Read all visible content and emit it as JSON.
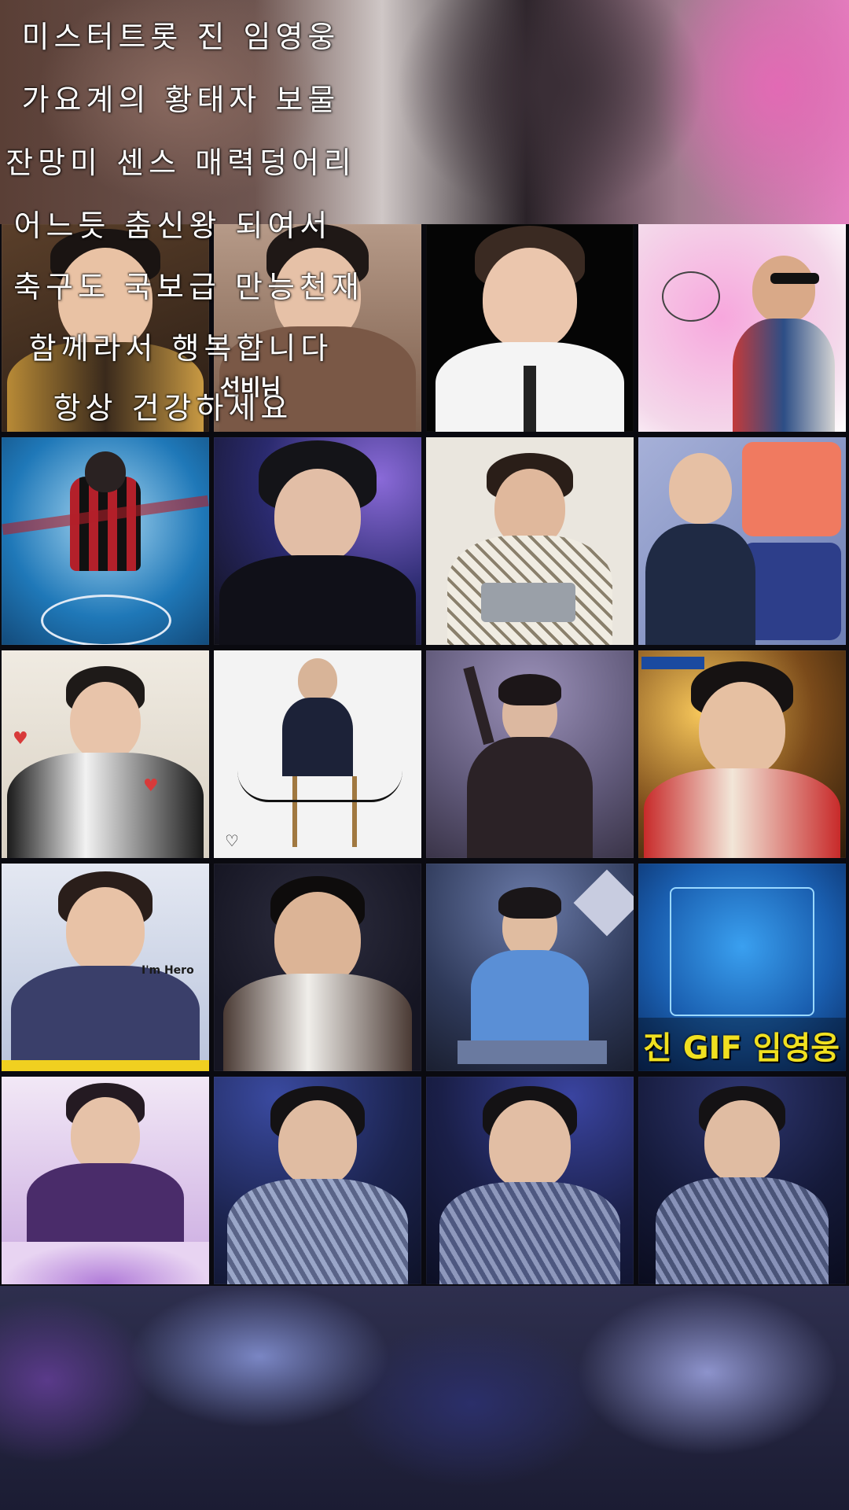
{
  "overlay_text": {
    "lines": [
      "미스터트롯 진 임영웅",
      "가요계의 황태자 보물",
      "잔망미 센스 매력덩어리",
      "어느듯 춤신왕 되여서",
      "축구도 국보급 만능천재",
      "함께라서 행복합니다",
      "항상 건강하세요"
    ]
  },
  "tiles": [
    {
      "id": "r1c1",
      "bg": "#3a2a1c",
      "accent": "#c99a43",
      "caption": ""
    },
    {
      "id": "r1c2",
      "bg": "#8a6a58",
      "accent": "#6e4e3c",
      "caption": "선비님"
    },
    {
      "id": "r1c3",
      "bg": "#050505",
      "accent": "#f4f4f4",
      "caption": ""
    },
    {
      "id": "r1c4",
      "bg": "#e98fcf",
      "accent": "#2d4e86",
      "caption": ""
    },
    {
      "id": "r2c1",
      "bg": "#1f78b8",
      "accent": "#b3202a",
      "caption": ""
    },
    {
      "id": "r2c2",
      "bg": "#2a2a6e",
      "accent": "#101018",
      "caption": ""
    },
    {
      "id": "r2c3",
      "bg": "#e8e4dc",
      "accent": "#c8c2b0",
      "caption": ""
    },
    {
      "id": "r2c4",
      "bg": "#6e7fb4",
      "accent": "#1f2a44",
      "caption": ""
    },
    {
      "id": "r3c1",
      "bg": "#e9e3d8",
      "accent": "#1a1a1a",
      "caption": ""
    },
    {
      "id": "r3c2",
      "bg": "#f2f2f2",
      "accent": "#1c2238",
      "caption": ""
    },
    {
      "id": "r3c3",
      "bg": "#5f5878",
      "accent": "#2b2226",
      "caption": ""
    },
    {
      "id": "r3c4",
      "bg": "#3a2a1a",
      "accent": "#c82a2a",
      "caption": ""
    },
    {
      "id": "r4c1",
      "bg": "#c9d3e6",
      "accent": "#3a3f6a",
      "caption": "I'm Hero"
    },
    {
      "id": "r4c2",
      "bg": "#151522",
      "accent": "#4a3a34",
      "caption": ""
    },
    {
      "id": "r4c3",
      "bg": "#2f3a5a",
      "accent": "#5a8fd6",
      "caption": ""
    },
    {
      "id": "r4c4",
      "bg": "#1a5fb0",
      "accent": "#f0e020",
      "caption": "진 GIF 임영웅"
    },
    {
      "id": "r5c1",
      "bg": "#d7c3e6",
      "accent": "#4a2c6a",
      "caption": ""
    },
    {
      "id": "r5c2",
      "bg": "#1c2450",
      "accent": "#9aa6c8",
      "caption": ""
    },
    {
      "id": "r5c3",
      "bg": "#1a1f48",
      "accent": "#8e98bc",
      "caption": ""
    },
    {
      "id": "r5c4",
      "bg": "#151a3a",
      "accent": "#8892b8",
      "caption": ""
    }
  ]
}
